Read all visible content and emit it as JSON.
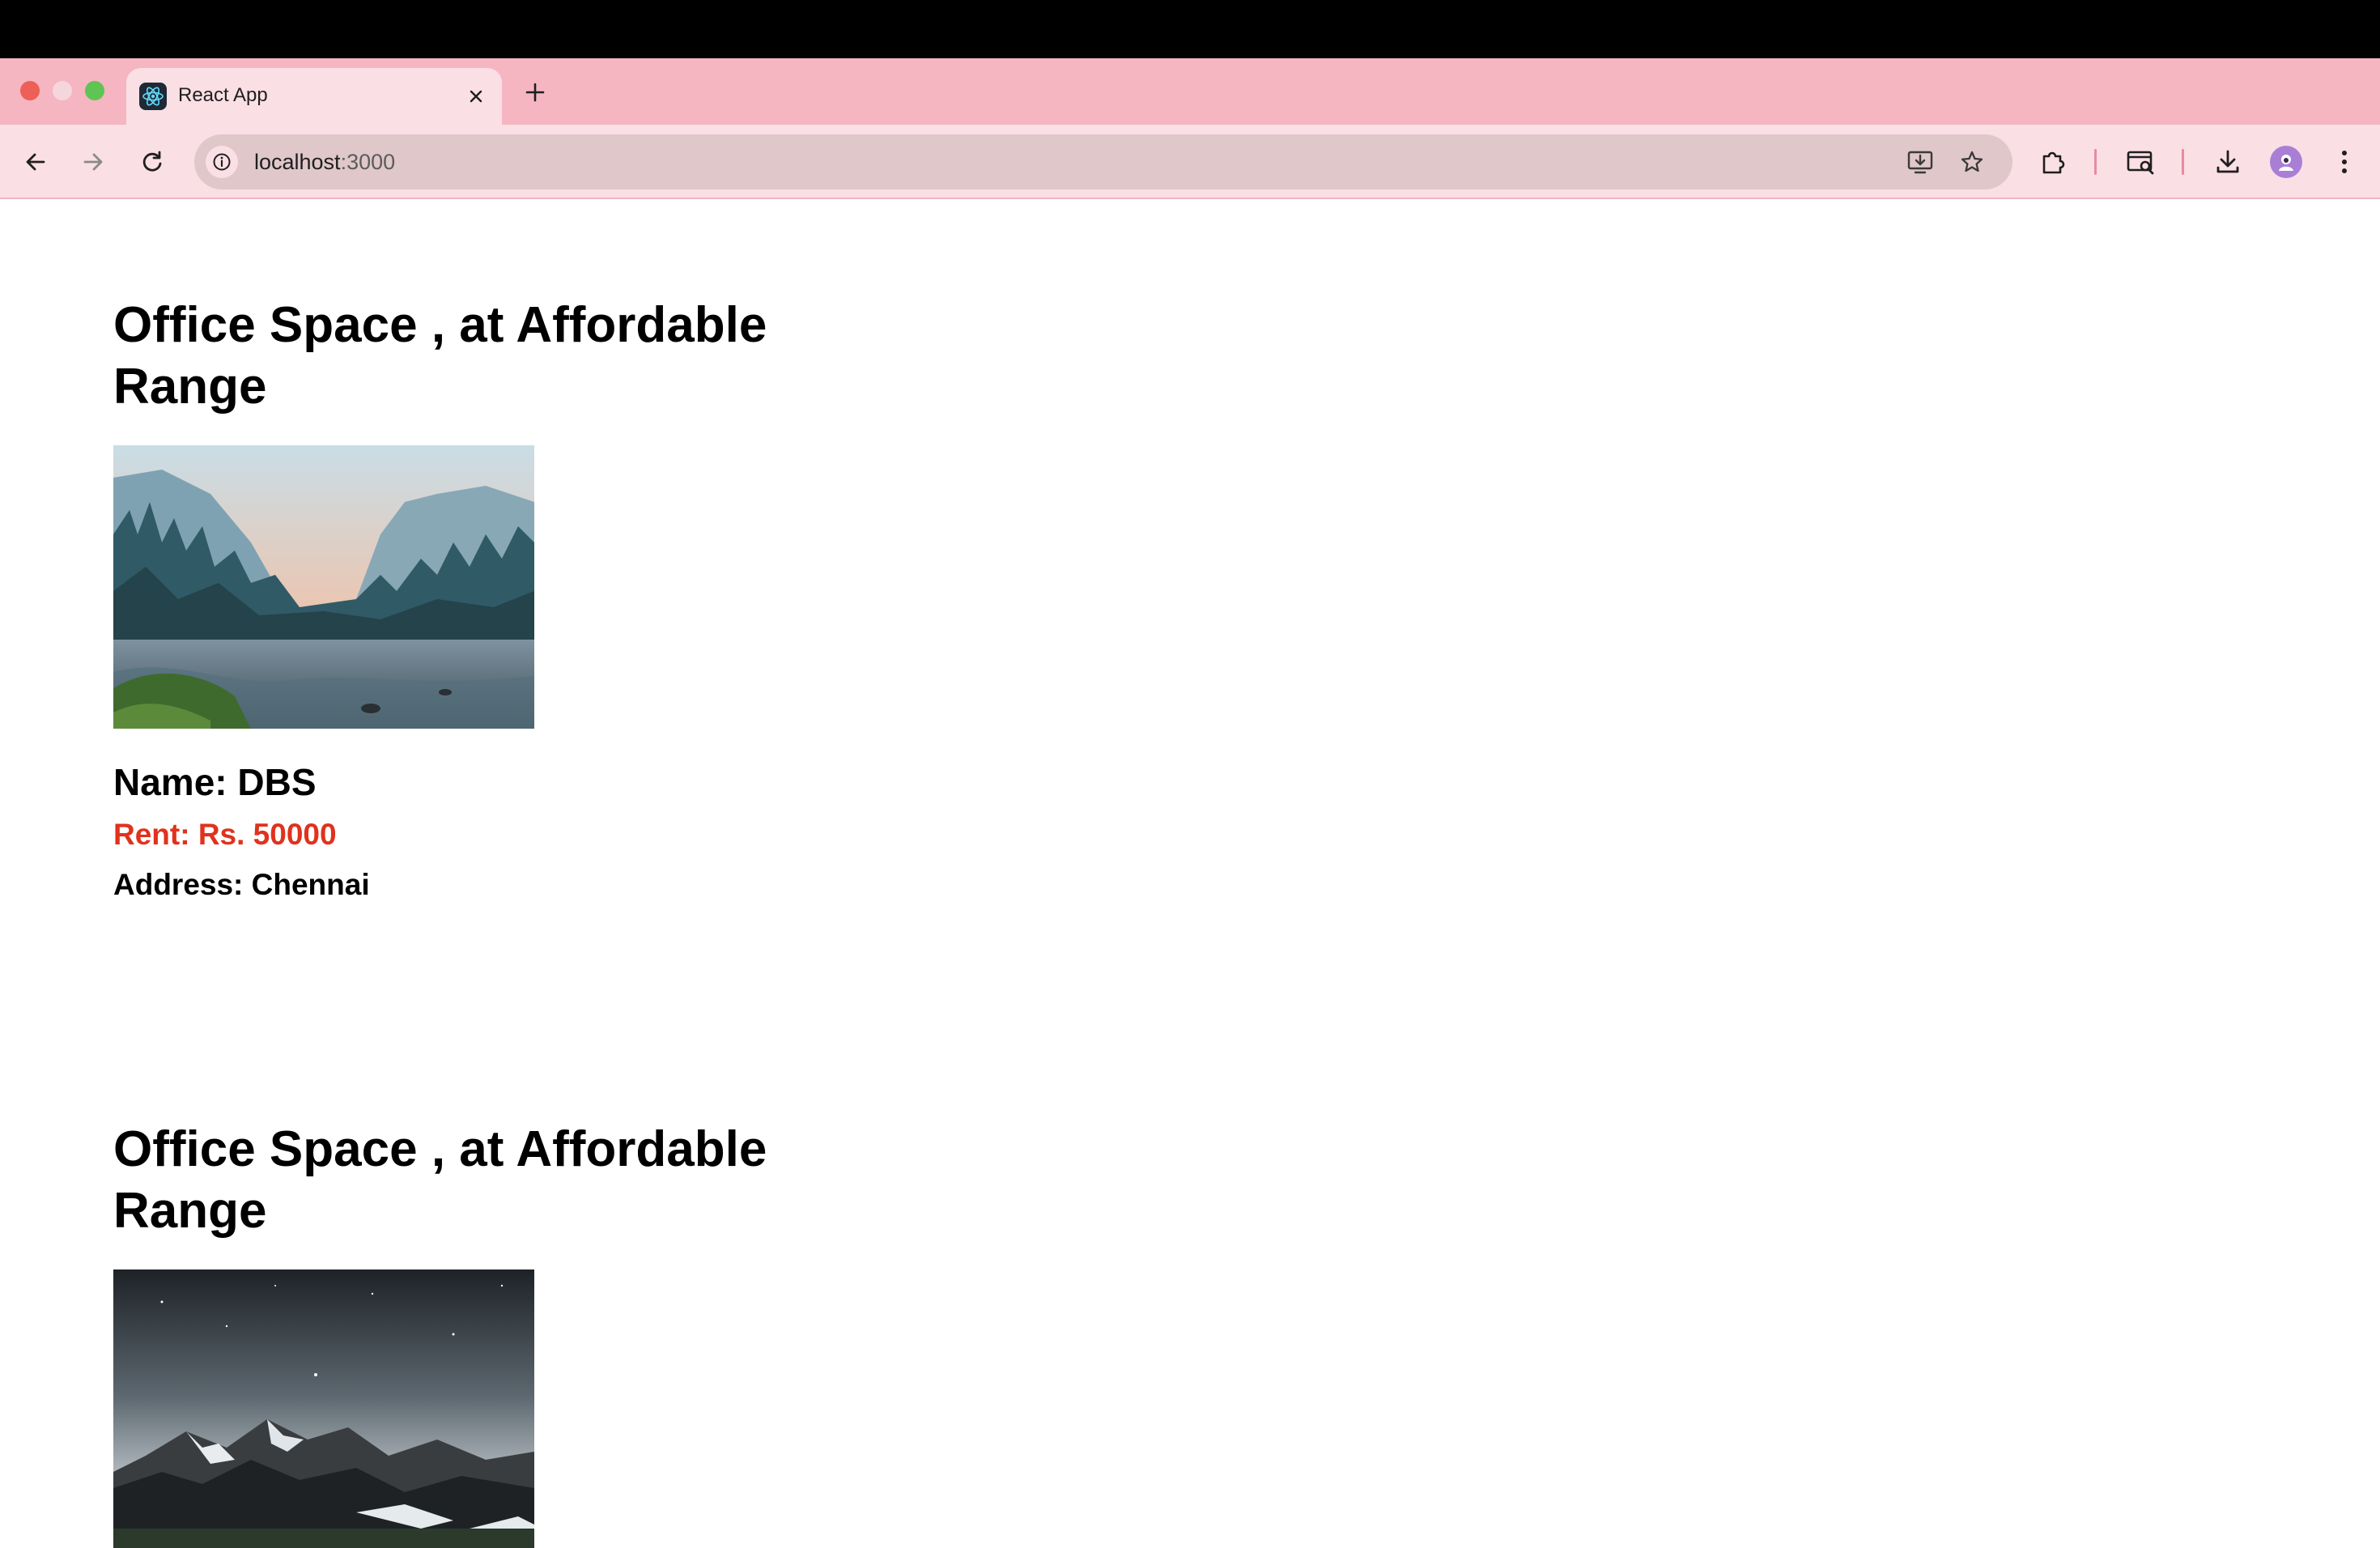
{
  "browser": {
    "tab_title": "React App",
    "url_host": "localhost",
    "url_port": ":3000"
  },
  "offices": [
    {
      "heading": "Office Space , at Affordable Range",
      "image": "valley-forest-river-photo",
      "name": "Name: DBS",
      "rent": "Rent: Rs. 50000",
      "address": "Address: Chennai"
    },
    {
      "heading": "Office Space , at Affordable Range",
      "image": "night-mountains-photo"
    }
  ],
  "colors": {
    "tab_strip": "#f5b5c1",
    "toolbar": "#fadfe5",
    "omnibox": "#e0c7ca",
    "rent_text": "#e0321d"
  }
}
